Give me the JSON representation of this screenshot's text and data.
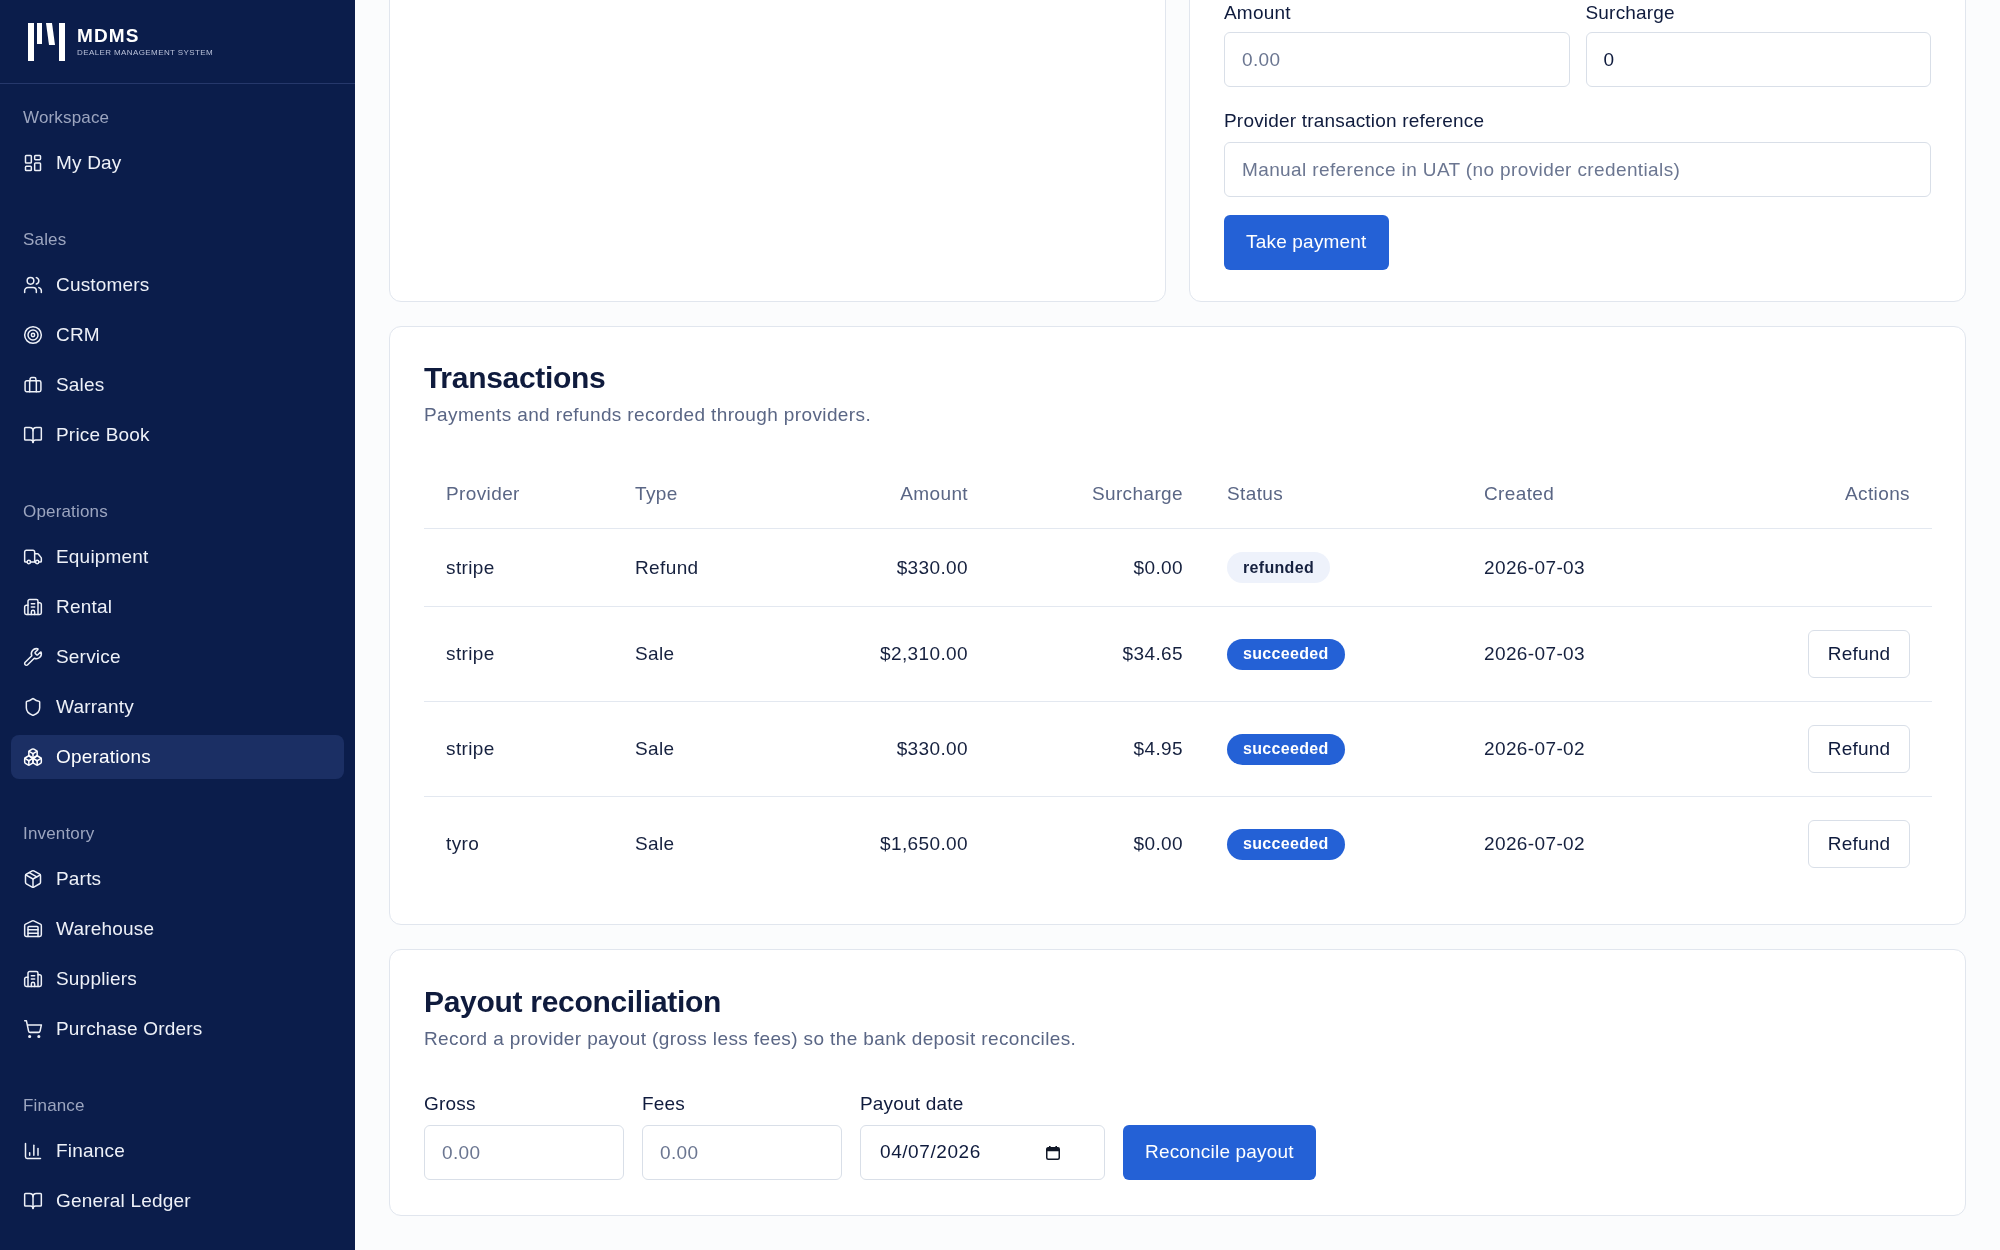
{
  "sidebar": {
    "logo": {
      "name": "MDMS",
      "tagline": "DEALER MANAGEMENT SYSTEM"
    },
    "sections": [
      {
        "title": "Workspace",
        "items": [
          {
            "label": "My Day",
            "selected": false
          }
        ]
      },
      {
        "title": "Sales",
        "items": [
          {
            "label": "Customers",
            "selected": false
          },
          {
            "label": "CRM",
            "selected": false
          },
          {
            "label": "Sales",
            "selected": false
          },
          {
            "label": "Price Book",
            "selected": false
          }
        ]
      },
      {
        "title": "Operations",
        "items": [
          {
            "label": "Equipment",
            "selected": false
          },
          {
            "label": "Rental",
            "selected": false
          },
          {
            "label": "Service",
            "selected": false
          },
          {
            "label": "Warranty",
            "selected": false
          },
          {
            "label": "Operations",
            "selected": true
          }
        ]
      },
      {
        "title": "Inventory",
        "items": [
          {
            "label": "Parts",
            "selected": false
          },
          {
            "label": "Warehouse",
            "selected": false
          },
          {
            "label": "Suppliers",
            "selected": false
          },
          {
            "label": "Purchase Orders",
            "selected": false
          }
        ]
      },
      {
        "title": "Finance",
        "items": [
          {
            "label": "Finance",
            "selected": false
          },
          {
            "label": "General Ledger",
            "selected": false
          }
        ]
      }
    ]
  },
  "payment_form": {
    "fields": [
      {
        "label": "Amount",
        "placeholder": "0.00"
      },
      {
        "label": "Surcharge",
        "value": "0"
      }
    ],
    "reference": {
      "label": "Provider transaction reference",
      "placeholder": "Manual reference in UAT (no provider credentials)"
    },
    "submit": "Take payment"
  },
  "transactions": {
    "title": "Transactions",
    "subtitle": "Payments and refunds recorded through providers.",
    "columns": [
      "Provider",
      "Type",
      "Amount",
      "Surcharge",
      "Status",
      "Created",
      "Actions"
    ],
    "rows": [
      {
        "provider": "stripe",
        "type": "Refund",
        "amount": "$330.00",
        "surcharge": "$0.00",
        "status": {
          "label": "refunded",
          "color": "#eef2fb"
        },
        "created": "2026-07-03"
      },
      {
        "provider": "stripe",
        "type": "Sale",
        "amount": "$2,310.00",
        "surcharge": "$34.65",
        "status": {
          "label": "succeeded",
          "color": "#2461d6"
        },
        "created": "2026-07-03",
        "action": "Refund"
      },
      {
        "provider": "stripe",
        "type": "Sale",
        "amount": "$330.00",
        "surcharge": "$4.95",
        "status": {
          "label": "succeeded",
          "color": "#2461d6"
        },
        "created": "2026-07-02",
        "action": "Refund"
      },
      {
        "provider": "tyro",
        "type": "Sale",
        "amount": "$1,650.00",
        "surcharge": "$0.00",
        "status": {
          "label": "succeeded",
          "color": "#2461d6"
        },
        "created": "2026-07-02",
        "action": "Refund"
      }
    ]
  },
  "payout": {
    "title": "Payout reconciliation",
    "subtitle": "Record a provider payout (gross less fees) so the bank deposit reconciles.",
    "fields": [
      {
        "label": "Gross",
        "placeholder": "0.00",
        "kind": "number"
      },
      {
        "label": "Fees",
        "placeholder": "0.00",
        "kind": "number"
      },
      {
        "label": "Payout date",
        "value": "04/07/2026",
        "kind": "date"
      }
    ],
    "submit": "Reconcile payout"
  }
}
